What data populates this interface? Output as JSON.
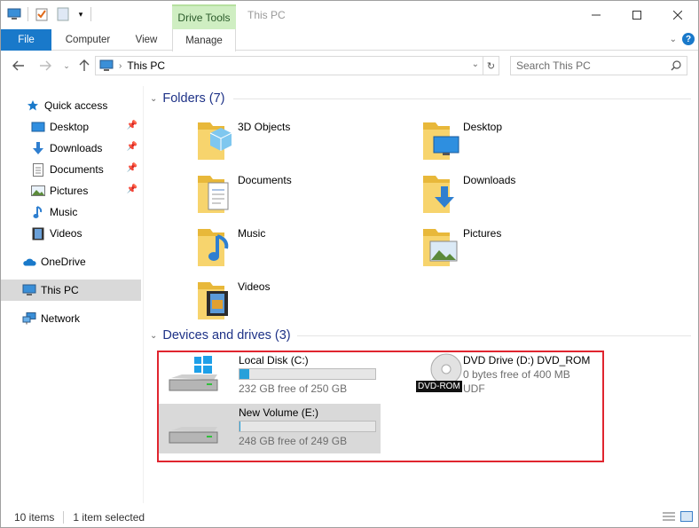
{
  "window": {
    "title": "This PC",
    "context_tab": "Drive Tools"
  },
  "ribbon": {
    "tabs": [
      "File",
      "Computer",
      "View",
      "Manage"
    ]
  },
  "address": {
    "path": "This PC",
    "search_placeholder": "Search This PC"
  },
  "nav": {
    "quick_access": "Quick access",
    "items": [
      {
        "label": "Desktop",
        "icon": "desktop-icon",
        "pinned": true
      },
      {
        "label": "Downloads",
        "icon": "download-icon",
        "pinned": true
      },
      {
        "label": "Documents",
        "icon": "documents-icon",
        "pinned": true
      },
      {
        "label": "Pictures",
        "icon": "pictures-icon",
        "pinned": true
      },
      {
        "label": "Music",
        "icon": "music-icon",
        "pinned": false
      },
      {
        "label": "Videos",
        "icon": "videos-icon",
        "pinned": false
      }
    ],
    "onedrive": "OneDrive",
    "this_pc": "This PC",
    "network": "Network"
  },
  "folders": {
    "header": "Folders (7)",
    "items": [
      {
        "label": "3D Objects",
        "icon": "3d-objects-folder-icon"
      },
      {
        "label": "Desktop",
        "icon": "desktop-folder-icon"
      },
      {
        "label": "Documents",
        "icon": "documents-folder-icon"
      },
      {
        "label": "Downloads",
        "icon": "downloads-folder-icon"
      },
      {
        "label": "Music",
        "icon": "music-folder-icon"
      },
      {
        "label": "Pictures",
        "icon": "pictures-folder-icon"
      },
      {
        "label": "Videos",
        "icon": "videos-folder-icon"
      }
    ]
  },
  "drives": {
    "header": "Devices and drives (3)",
    "items": [
      {
        "name": "Local Disk (C:)",
        "free": "232 GB free of 250 GB",
        "used_fraction": 0.072,
        "icon": "windows-drive-icon"
      },
      {
        "name": "DVD Drive (D:) DVD_ROM",
        "line2": "0 bytes free of 400 MB",
        "line3": "UDF",
        "icon_badge": "DVD-ROM",
        "icon": "dvd-drive-icon"
      },
      {
        "name": "New Volume (E:)",
        "free": "248 GB free of 249 GB",
        "used_fraction": 0.004,
        "icon": "hard-drive-icon"
      }
    ]
  },
  "status": {
    "items_count": "10 items",
    "selected": "1 item selected"
  },
  "colors": {
    "accent": "#1979ca",
    "header_blue": "#1e3287",
    "drive_tools_bg": "#cfeec2",
    "highlight_box": "#e0252f"
  }
}
